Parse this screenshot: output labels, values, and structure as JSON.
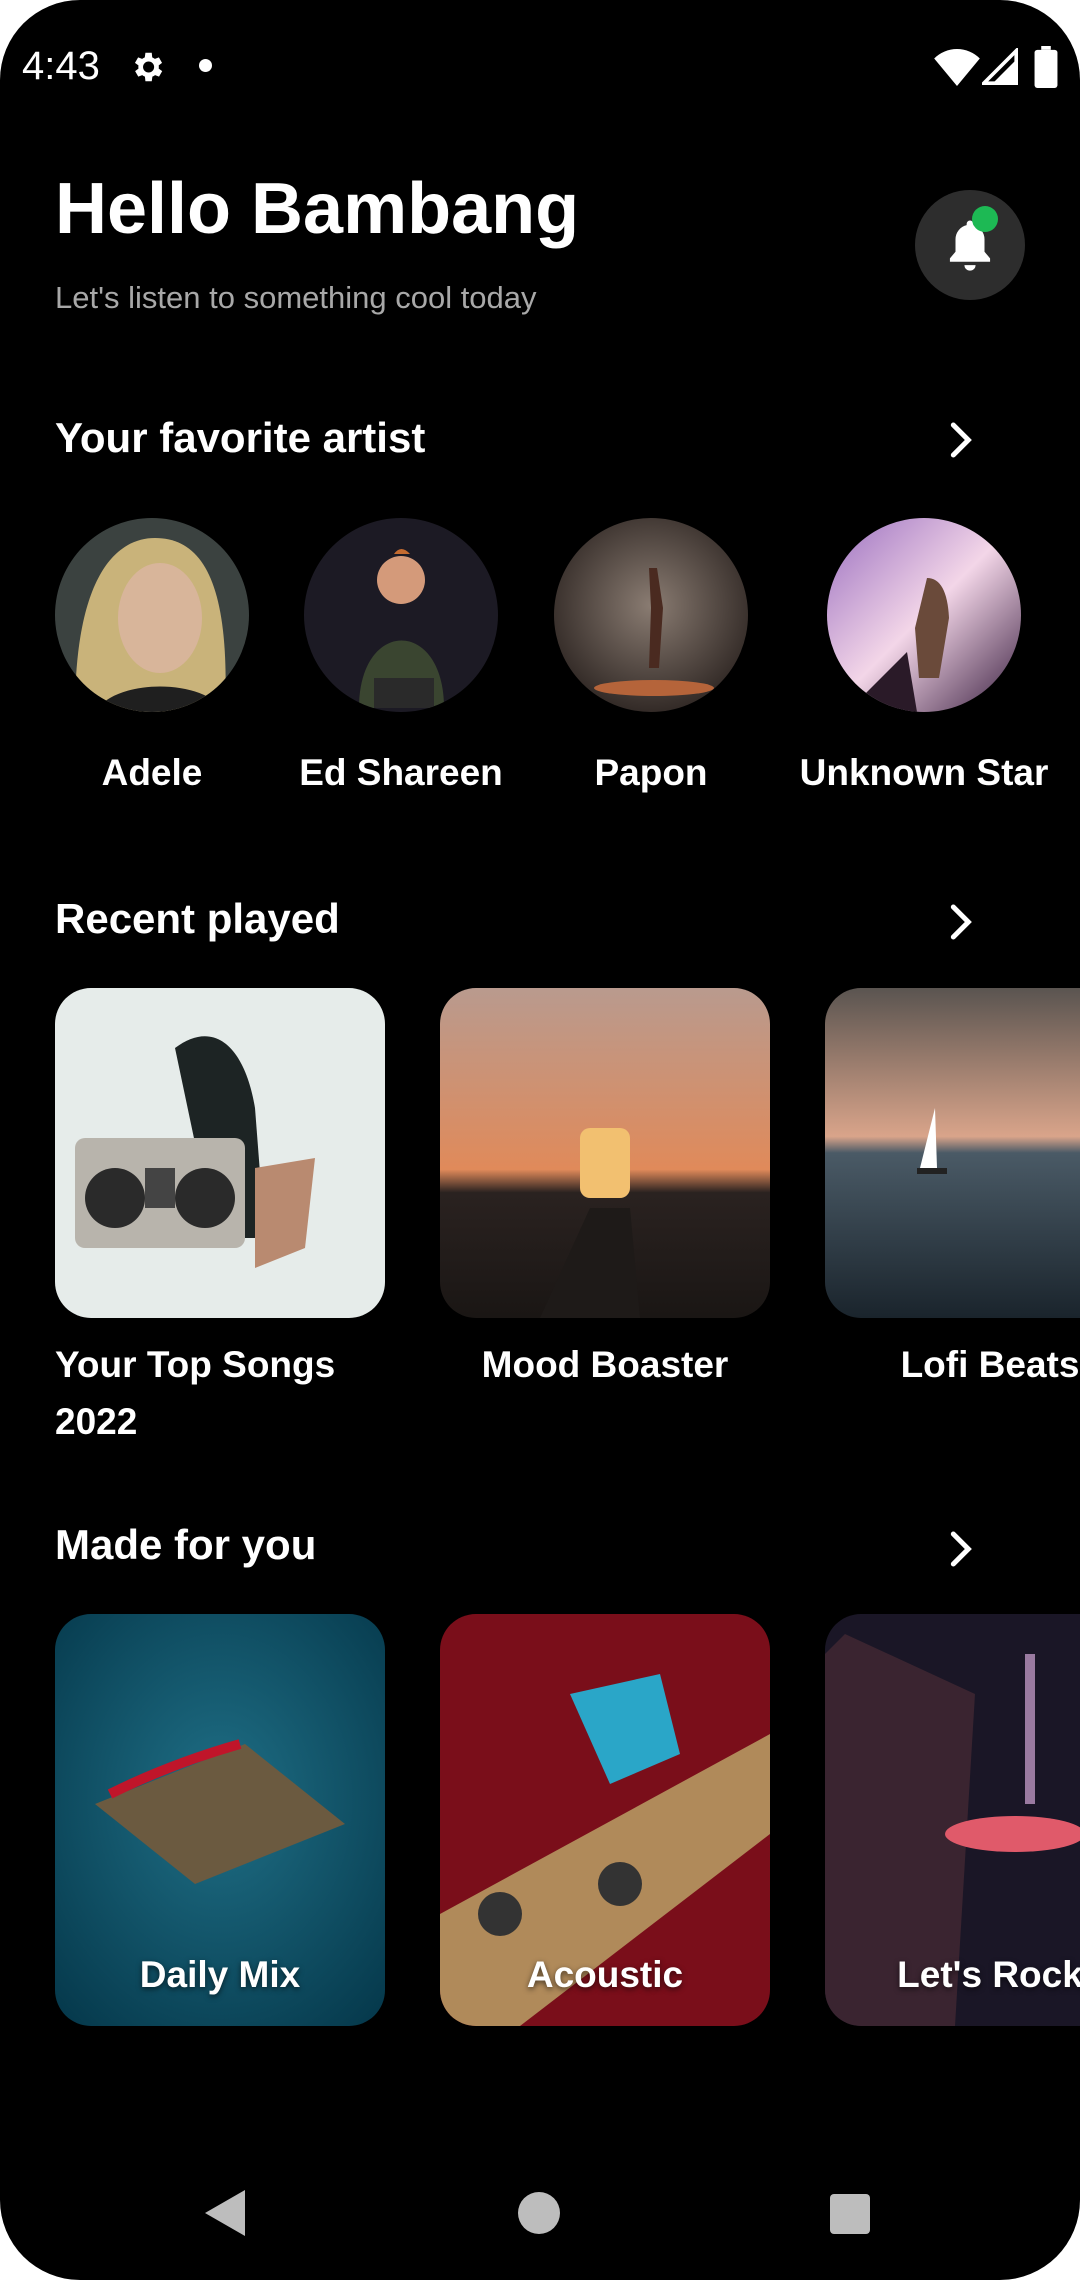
{
  "status": {
    "time": "4:43"
  },
  "header": {
    "greeting": "Hello Bambang",
    "subtitle": "Let's listen to something cool today"
  },
  "sections": {
    "favorite_artist": "Your favorite artist",
    "recent_played": "Recent played",
    "made_for_you": "Made for you"
  },
  "artists": [
    {
      "name": "Adele"
    },
    {
      "name": "Ed Shareen"
    },
    {
      "name": "Papon"
    },
    {
      "name": "Unknown Star"
    }
  ],
  "recent": [
    {
      "title": "Your Top Songs 2022"
    },
    {
      "title": "Mood Boaster"
    },
    {
      "title": "Lofi Beats"
    }
  ],
  "made_for_you": [
    {
      "title": "Daily Mix"
    },
    {
      "title": "Acoustic"
    },
    {
      "title": "Let's Rock"
    }
  ],
  "colors": {
    "background": "#000000",
    "accent": "#1db954",
    "subtitle": "#a8a8a8"
  }
}
